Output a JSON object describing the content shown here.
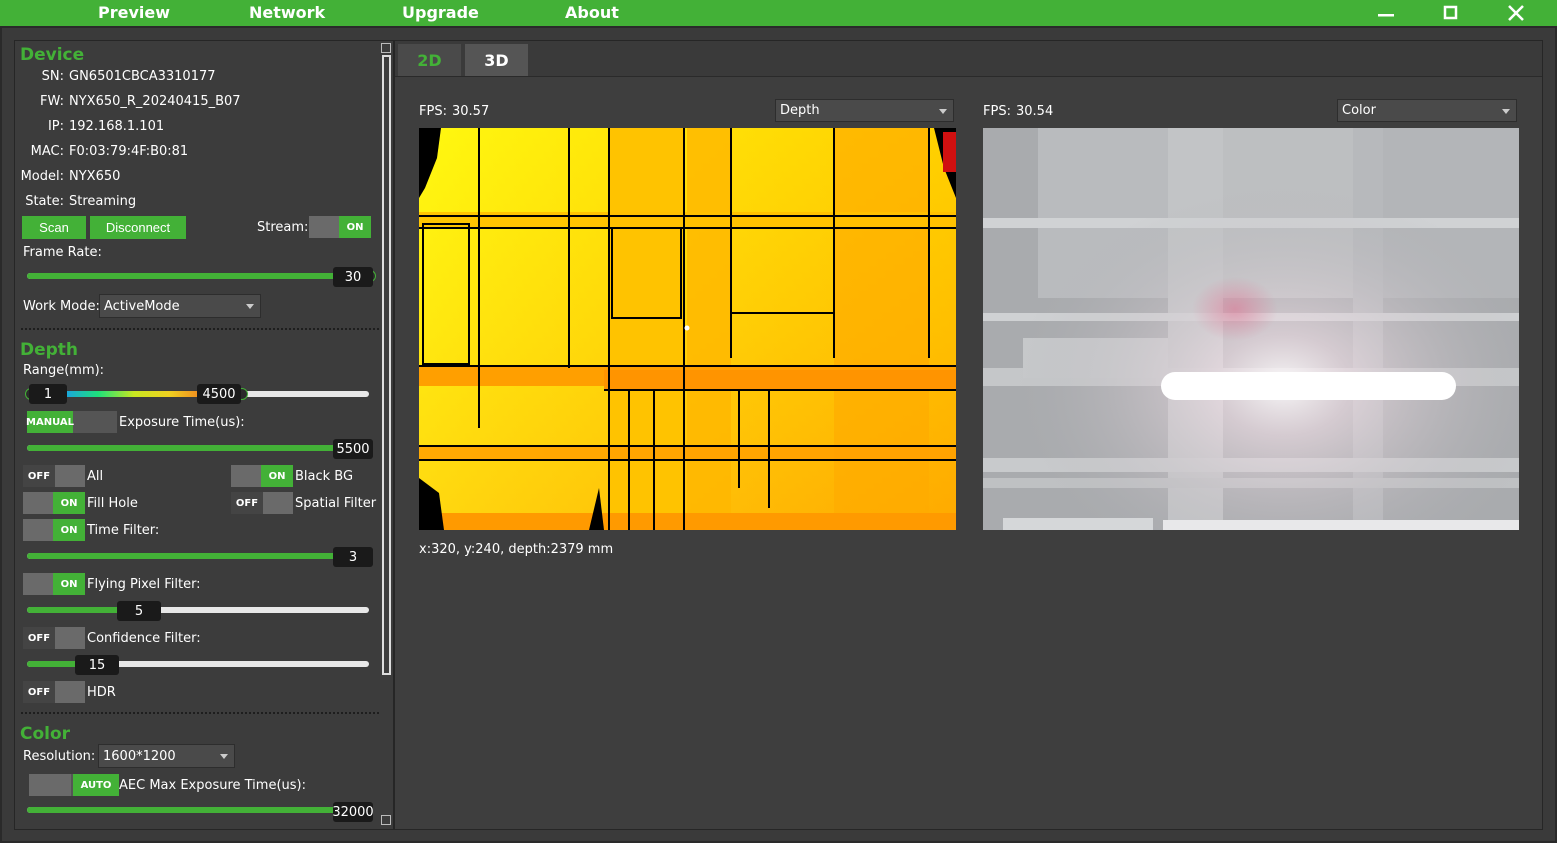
{
  "menu": {
    "preview": "Preview",
    "network": "Network",
    "upgrade": "Upgrade",
    "about": "About"
  },
  "device": {
    "title": "Device",
    "sn_label": "SN:",
    "sn": "GN6501CBCA3310177",
    "fw_label": "FW:",
    "fw": "NYX650_R_20240415_B07",
    "ip_label": "IP:",
    "ip": "192.168.1.101",
    "mac_label": "MAC:",
    "mac": "F0:03:79:4F:B0:81",
    "model_label": "Model:",
    "model": "NYX650",
    "state_label": "State:",
    "state": "Streaming",
    "scan": "Scan",
    "disconnect": "Disconnect",
    "stream_label": "Stream:",
    "stream_state": "ON",
    "frame_rate_label": "Frame Rate:",
    "frame_rate": "30",
    "frame_rate_fraction": 0.98,
    "work_mode_label": "Work Mode:",
    "work_mode": "ActiveMode"
  },
  "depth": {
    "title": "Depth",
    "range_label": "Range(mm):",
    "range_min": "1",
    "range_max": "4500",
    "exposure_mode": "MANUAL",
    "exposure_label": "Exposure Time(us):",
    "exposure": "5500",
    "all_state": "OFF",
    "all_label": "All",
    "black_bg_state": "ON",
    "black_bg_label": "Black BG",
    "fill_hole_state": "ON",
    "fill_hole_label": "Fill Hole",
    "spatial_state": "OFF",
    "spatial_label": "Spatial Filter",
    "time_filter_state": "ON",
    "time_filter_label": "Time Filter:",
    "time_filter": "3",
    "flying_state": "ON",
    "flying_label": "Flying Pixel Filter:",
    "flying": "5",
    "confidence_state": "OFF",
    "confidence_label": "Confidence Filter:",
    "confidence": "15",
    "hdr_state": "OFF",
    "hdr_label": "HDR"
  },
  "color": {
    "title": "Color",
    "resolution_label": "Resolution:",
    "resolution": "1600*1200",
    "aec_state": "AUTO",
    "aec_label": "AEC Max Exposure Time(us):",
    "aec": "32000"
  },
  "tabs": {
    "tab_2d": "2D",
    "tab_3d": "3D"
  },
  "views": {
    "left_fps_label": "FPS:",
    "left_fps": "30.57",
    "left_mode": "Depth",
    "right_fps_label": "FPS:",
    "right_fps": "30.54",
    "right_mode": "Color",
    "readout": "x:320, y:240, depth:2379 mm"
  },
  "colors": {
    "accent": "#43b137",
    "background": "#333333",
    "panel": "#3c3c3c"
  }
}
